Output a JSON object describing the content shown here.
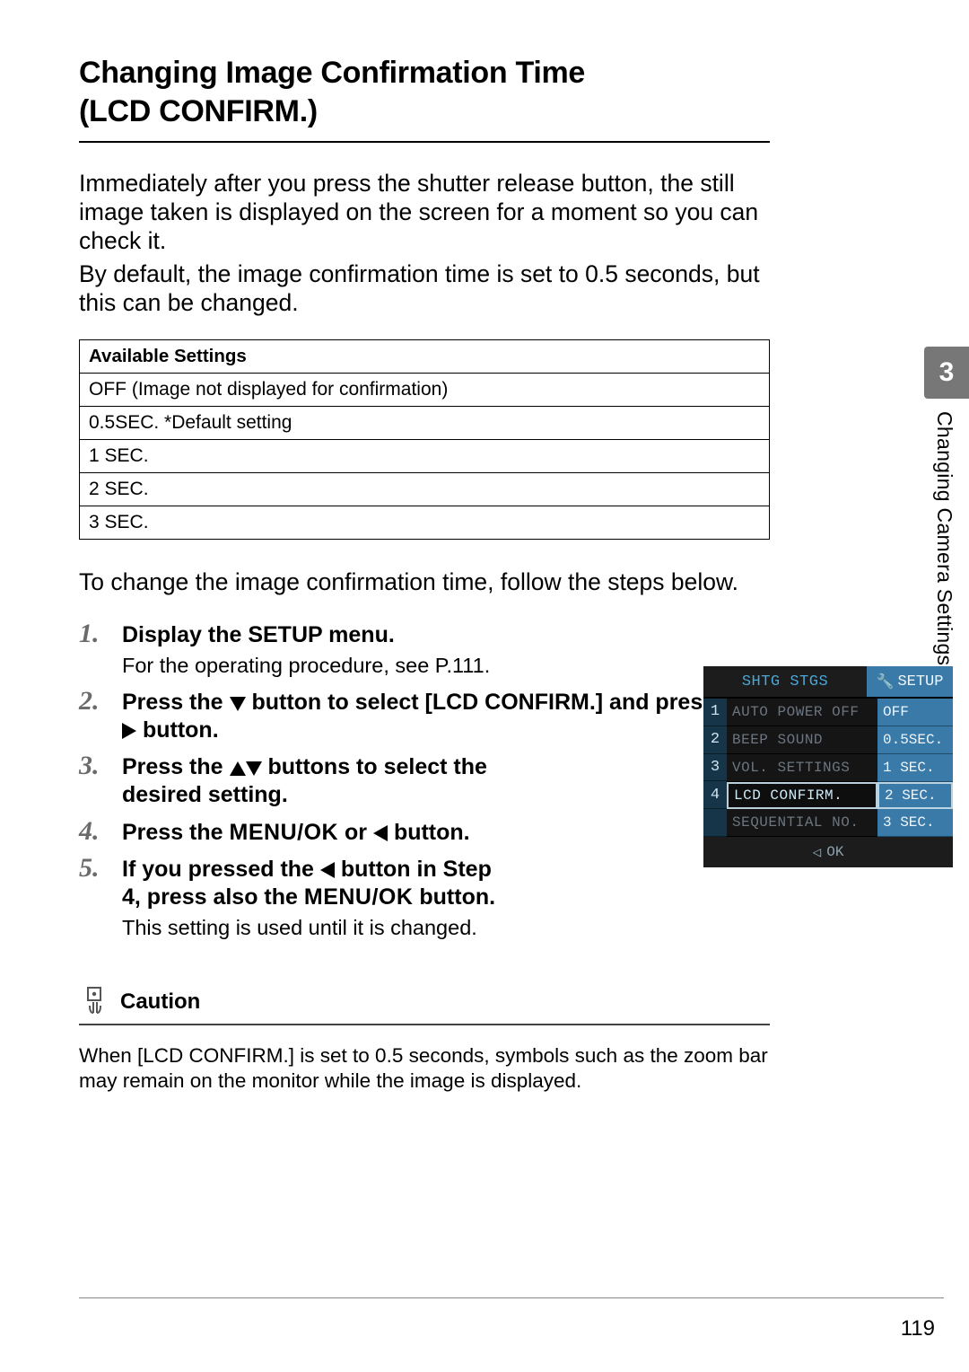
{
  "title_line1": "Changing Image Confirmation Time",
  "title_line2": "(LCD CONFIRM.)",
  "intro_p1": "Immediately after you press the shutter release button, the still image taken is displayed on the screen for a moment so you can check it.",
  "intro_p2": "By default, the image confirmation time is set to 0.5 seconds, but this can be changed.",
  "table": {
    "header": "Available Settings",
    "rows": [
      "OFF (Image not displayed for confirmation)",
      "0.5SEC. *Default setting",
      "1 SEC.",
      "2 SEC.",
      "3 SEC."
    ]
  },
  "intro2": "To change the image confirmation time, follow the steps below.",
  "steps": {
    "s1_head": "Display the SETUP menu.",
    "s1_sub": "For the operating procedure, see P.111.",
    "s2_a": "Press the ",
    "s2_b": " button to select [LCD CONFIRM.] and press the ",
    "s2_c": " button.",
    "s3_a": "Press the ",
    "s3_b": " buttons to select the desired setting.",
    "s4_a": "Press the ",
    "s4_menuok": "MENU/OK",
    "s4_b": " or ",
    "s4_c": " button.",
    "s5_a": "If you pressed the ",
    "s5_b": " button in Step 4, press also the ",
    "s5_menuok": "MENU/OK",
    "s5_c": " button.",
    "s5_sub": "This setting is used until it is changed."
  },
  "lcd": {
    "tab1": "SHTG STGS",
    "tab2": "SETUP",
    "pages": [
      "1",
      "2",
      "3",
      "4"
    ],
    "rows": [
      "AUTO POWER OFF",
      "BEEP SOUND",
      "VOL. SETTINGS",
      "LCD CONFIRM.",
      "SEQUENTIAL NO."
    ],
    "opts": [
      "OFF",
      "0.5SEC.",
      "1 SEC.",
      "2 SEC.",
      "3 SEC."
    ],
    "foot": "OK"
  },
  "caution": {
    "title": "Caution",
    "text": "When [LCD CONFIRM.] is set to 0.5 seconds, symbols such as the zoom bar may remain on the monitor while the image is displayed."
  },
  "side": {
    "chapter": "3",
    "label": "Changing Camera Settings"
  },
  "page_number": "119"
}
